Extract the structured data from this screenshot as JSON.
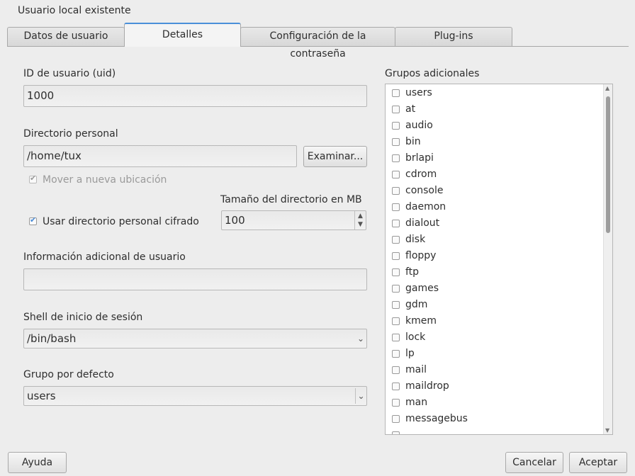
{
  "window": {
    "title": "Usuario local existente"
  },
  "tabs": [
    {
      "label": "Datos de usuario"
    },
    {
      "label": "Detalles"
    },
    {
      "label": "Configuración de la contraseña"
    },
    {
      "label": "Plug-ins"
    }
  ],
  "uid": {
    "label": "ID de usuario (uid)",
    "value": "1000"
  },
  "home": {
    "label": "Directorio personal",
    "value": "/home/tux",
    "browse_label": "Examinar...",
    "move_label": "Mover a nueva ubicación",
    "move_checked": true
  },
  "encrypted": {
    "label": "Usar directorio personal cifrado",
    "checked": true,
    "size_label": "Tamaño del directorio en MB",
    "size_value": "100"
  },
  "extra_info": {
    "label": "Información adicional de usuario",
    "value": ""
  },
  "shell": {
    "label": "Shell de inicio de sesión",
    "value": "/bin/bash"
  },
  "default_group": {
    "label": "Grupo por defecto",
    "value": "users"
  },
  "groups": {
    "label": "Grupos adicionales",
    "items": [
      "users",
      "at",
      "audio",
      "bin",
      "brlapi",
      "cdrom",
      "console",
      "daemon",
      "dialout",
      "disk",
      "floppy",
      "ftp",
      "games",
      "gdm",
      "kmem",
      "lock",
      "lp",
      "mail",
      "maildrop",
      "man",
      "messagebus"
    ]
  },
  "footer": {
    "help": "Ayuda",
    "cancel": "Cancelar",
    "accept": "Aceptar"
  }
}
